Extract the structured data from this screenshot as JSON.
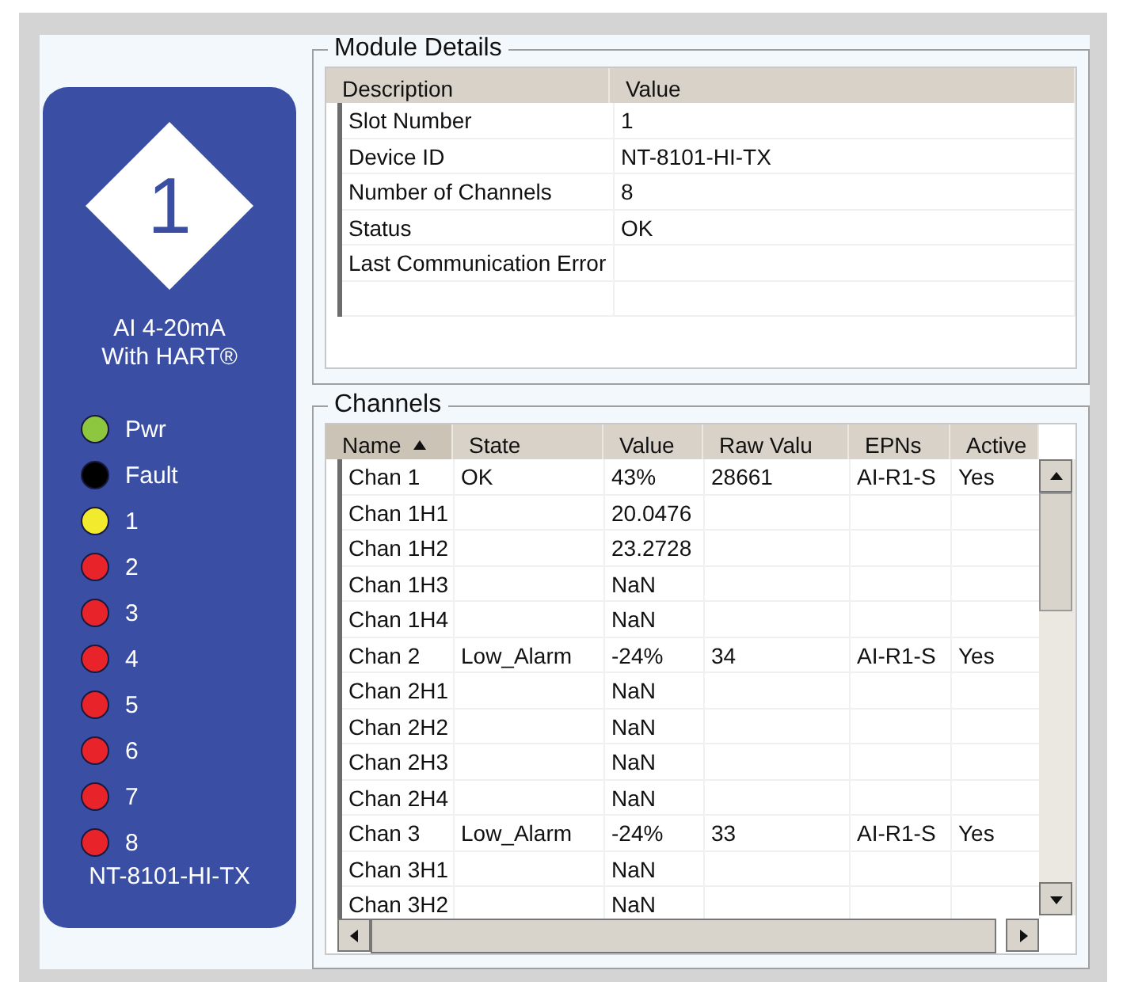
{
  "module_card": {
    "slot": "1",
    "type_lines": [
      "AI 4-20mA",
      "With HART®"
    ],
    "leds": [
      {
        "label": "Pwr",
        "color": "#8dc63f"
      },
      {
        "label": "Fault",
        "color": "#000000"
      },
      {
        "label": "1",
        "color": "#f2ea2c"
      },
      {
        "label": "2",
        "color": "#e8242a"
      },
      {
        "label": "3",
        "color": "#e8242a"
      },
      {
        "label": "4",
        "color": "#e8242a"
      },
      {
        "label": "5",
        "color": "#e8242a"
      },
      {
        "label": "6",
        "color": "#e8242a"
      },
      {
        "label": "7",
        "color": "#e8242a"
      },
      {
        "label": "8",
        "color": "#e8242a"
      }
    ],
    "device": "NT-8101-HI-TX"
  },
  "module_details": {
    "title": "Module Details",
    "columns": [
      "Description",
      "Value"
    ],
    "rows": [
      [
        "Slot Number",
        "1"
      ],
      [
        "Device ID",
        "NT-8101-HI-TX"
      ],
      [
        "Number of Channels",
        "8"
      ],
      [
        "Status",
        "OK"
      ],
      [
        "Last Communication Error",
        ""
      ]
    ]
  },
  "channels": {
    "title": "Channels",
    "columns": [
      {
        "label": "Name",
        "sorted": true
      },
      {
        "label": "State",
        "sorted": false
      },
      {
        "label": "Value",
        "sorted": false
      },
      {
        "label": "Raw Valu",
        "sorted": false
      },
      {
        "label": "EPNs",
        "sorted": false
      },
      {
        "label": "Active",
        "sorted": false
      }
    ],
    "rows": [
      [
        "Chan 1",
        "OK",
        "43%",
        "28661",
        "AI-R1-S",
        "Yes"
      ],
      [
        "Chan 1H1",
        "",
        "20.0476",
        "",
        "",
        ""
      ],
      [
        "Chan 1H2",
        "",
        "23.2728",
        "",
        "",
        ""
      ],
      [
        "Chan 1H3",
        "",
        "NaN",
        "",
        "",
        ""
      ],
      [
        "Chan 1H4",
        "",
        "NaN",
        "",
        "",
        ""
      ],
      [
        "Chan 2",
        "Low_Alarm",
        "-24%",
        "34",
        "AI-R1-S",
        "Yes"
      ],
      [
        "Chan 2H1",
        "",
        "NaN",
        "",
        "",
        ""
      ],
      [
        "Chan 2H2",
        "",
        "NaN",
        "",
        "",
        ""
      ],
      [
        "Chan 2H3",
        "",
        "NaN",
        "",
        "",
        ""
      ],
      [
        "Chan 2H4",
        "",
        "NaN",
        "",
        "",
        ""
      ],
      [
        "Chan 3",
        "Low_Alarm",
        "-24%",
        "33",
        "AI-R1-S",
        "Yes"
      ],
      [
        "Chan 3H1",
        "",
        "NaN",
        "",
        "",
        ""
      ],
      [
        "Chan 3H2",
        "",
        "NaN",
        "",
        "",
        ""
      ]
    ]
  }
}
